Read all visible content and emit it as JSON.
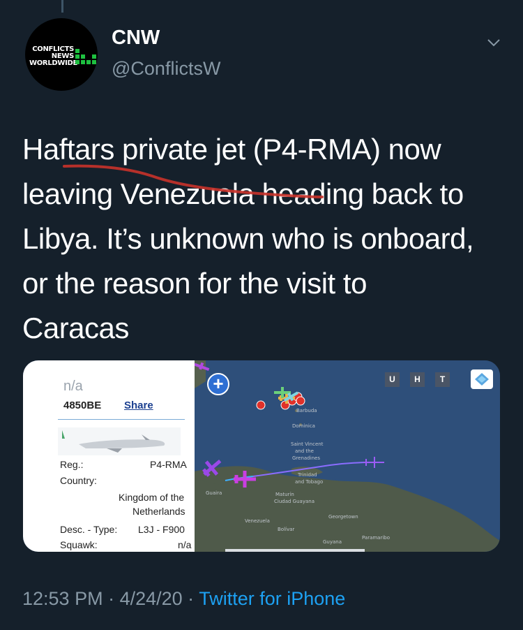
{
  "author": {
    "name": "CNW",
    "handle": "@ConflictsW",
    "avatar_text": [
      "CONFLICTS",
      "NEWS",
      "WORLDWIDE"
    ]
  },
  "tweet": {
    "lines": [
      "Haftars private jet  (P4-RMA) now",
      "leaving Venezuela heading back to",
      "Libya. It’s unknown who is onboard,",
      "or the reason for the visit to",
      "Caracas"
    ]
  },
  "media": {
    "flight_panel": {
      "callsign": "n/a",
      "hex": "4850BE",
      "share_label": "Share",
      "reg_label": "Reg.:",
      "reg_value": "P4-RMA",
      "country_label": "Country:",
      "country_value_line1": "Kingdom of the",
      "country_value_line2": "Netherlands",
      "desc_label": "Desc. - Type:",
      "desc_value": "L3J - F900",
      "squawk_label": "Squawk:",
      "squawk_value": "n/a"
    },
    "map_controls": [
      "U",
      "H",
      "T"
    ],
    "zoom_in": "+",
    "map_labels": [
      "Barbuda",
      "Dominica",
      "Saint Vincent",
      "and the",
      "Grenadines",
      "Trinidad",
      "and Tobago",
      "Maturín",
      "Ciudad Guayana",
      "Venezuela",
      "Georgetown",
      "Guyana",
      "Paramaribo",
      "Bolívar",
      "Guaira"
    ]
  },
  "footer": {
    "time": "12:53 PM",
    "sep1": " · ",
    "date": "4/24/20",
    "sep2": " · ",
    "via": "Twitter for iPhone"
  },
  "colors": {
    "background": "#15202b",
    "secondary_text": "#8899a6",
    "link": "#1da1f2",
    "map_sea": "#2e4f7a",
    "map_land": "#4f5a4a"
  }
}
